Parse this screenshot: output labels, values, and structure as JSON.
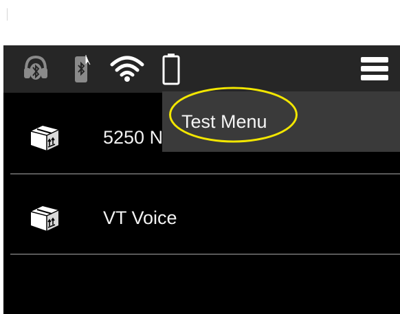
{
  "status_bar": {
    "icons": [
      "bluetooth-headset-icon",
      "bluetooth-device-icon",
      "wifi-icon",
      "battery-icon"
    ]
  },
  "menu_button": {
    "icon": "hamburger-menu-icon"
  },
  "apps": [
    {
      "label": "5250 N",
      "icon": "package-box-icon"
    },
    {
      "label": "VT Voice",
      "icon": "package-box-icon"
    }
  ],
  "dropdown": {
    "items": [
      {
        "label": "Test Menu"
      }
    ]
  },
  "colors": {
    "status_bar_bg": "#262626",
    "screen_bg": "#000000",
    "dropdown_bg": "#3a3a3a",
    "highlight": "#f2e600"
  }
}
